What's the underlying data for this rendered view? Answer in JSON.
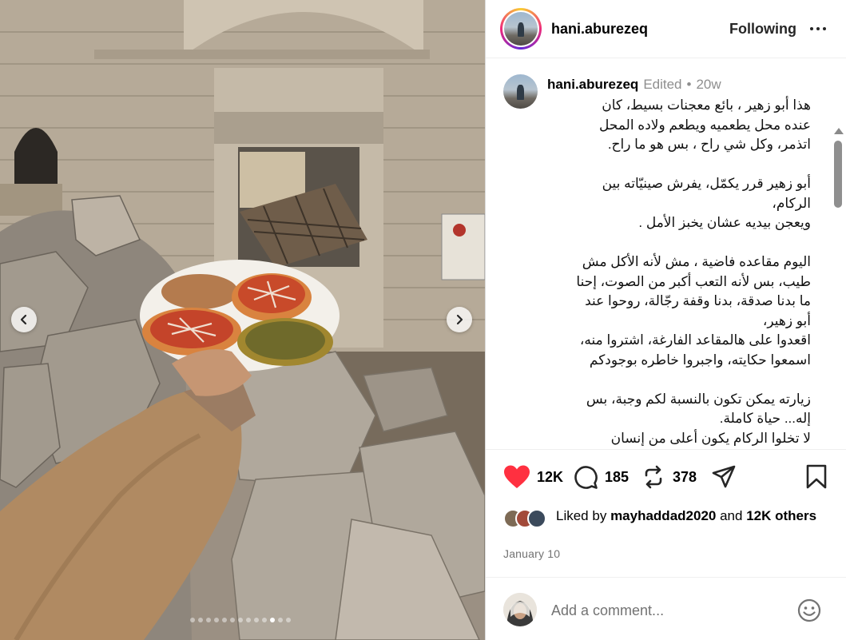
{
  "post": {
    "username": "hani.aburezeq",
    "follow_label": "Following",
    "edited_label": "Edited",
    "separator": "•",
    "age": "20w",
    "caption": "هذا أبو زهير ، بائع معجنات بسيط، كان\nعنده محل يطعميه ويطعم ولاده المحل\nاتذمر، وكل شي راح ، بس هو ما راح.\n\nأبو زهير قرر يكمّل، يفرش صينيّاته بين\nالركام،\nويعجن بيديه عشان يخبز الأمل .\n\nاليوم مقاعده فاضية ، مش لأنه الأكل مش\nطيب، بس لأنه التعب أكبر من الصوت، إحنا\nما بدنا صدقة، بدنا وقفة رجّالة، روحوا عند\nأبو زهير،\nاقعدوا على هالمقاعد الفارغة، اشتروا منه،\nاسمعوا حكايته، واجبروا خاطره بوجودكم\n\nزيارته يمكن تكون بالنسبة لكم وجبة، بس\nإله... حياة كاملة.\nلا تخلوا الركام يكون أعلى من إنسان"
  },
  "actions": {
    "likes": "12K",
    "comments": "185",
    "reposts": "378"
  },
  "liked_by": {
    "prefix": "Liked by",
    "user": "mayhaddad2020",
    "and": "and",
    "count": "12K",
    "suffix": "others"
  },
  "date": "January 10",
  "comment": {
    "placeholder": "Add a comment..."
  },
  "carousel": {
    "total": 13,
    "active_index": 10
  },
  "colors": {
    "like_red": "#ff3040",
    "text": "#000000",
    "secondary": "#8e8e8e"
  },
  "icons": {
    "like": "heart-icon",
    "comment": "speech-bubble-icon",
    "repost": "repost-icon",
    "share": "paper-plane-icon",
    "save": "bookmark-icon",
    "emoji": "smiley-icon"
  }
}
